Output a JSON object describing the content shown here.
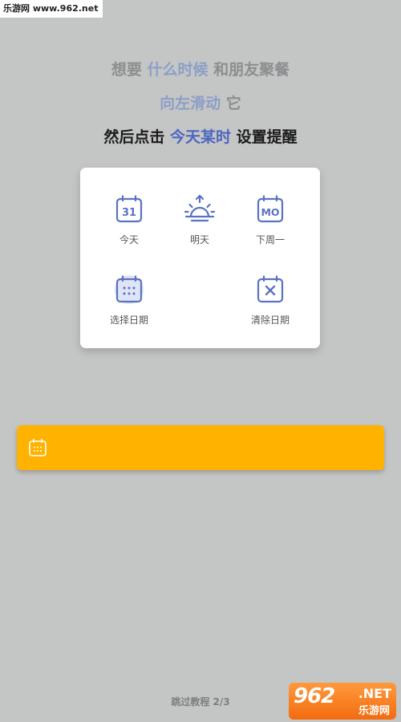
{
  "watermark_top": "乐游网 www.962.net",
  "headline": {
    "line1": {
      "pre": "想要 ",
      "accent": "什么时候",
      "post": " 和朋友聚餐"
    },
    "line2": {
      "accent": "向左滑动",
      "post": " 它"
    },
    "line3": {
      "pre": "然后点击 ",
      "accent": "今天某时",
      "post": " 设置提醒"
    }
  },
  "date_options": {
    "today": {
      "label": "今天",
      "icon": "calendar-31-icon",
      "icon_text": "31"
    },
    "tomorrow": {
      "label": "明天",
      "icon": "sunrise-icon"
    },
    "next_week": {
      "label": "下周一",
      "icon": "calendar-mo-icon",
      "icon_text": "MO"
    },
    "pick_date": {
      "label": "选择日期",
      "icon": "calendar-grid-icon"
    },
    "clear_date": {
      "label": "清除日期",
      "icon": "calendar-x-icon"
    }
  },
  "task_bar": {
    "icon": "calendar-icon"
  },
  "skip_tutorial": "跳过教程 2/3",
  "logo": {
    "big": "962",
    "net": ".NET",
    "small": "乐游网"
  },
  "colors": {
    "background": "#c4c5c5",
    "accent_blue": "#4d67c0",
    "icon_blue": "#5a72c4",
    "task_bar": "#ffb300",
    "card": "#ffffff"
  }
}
